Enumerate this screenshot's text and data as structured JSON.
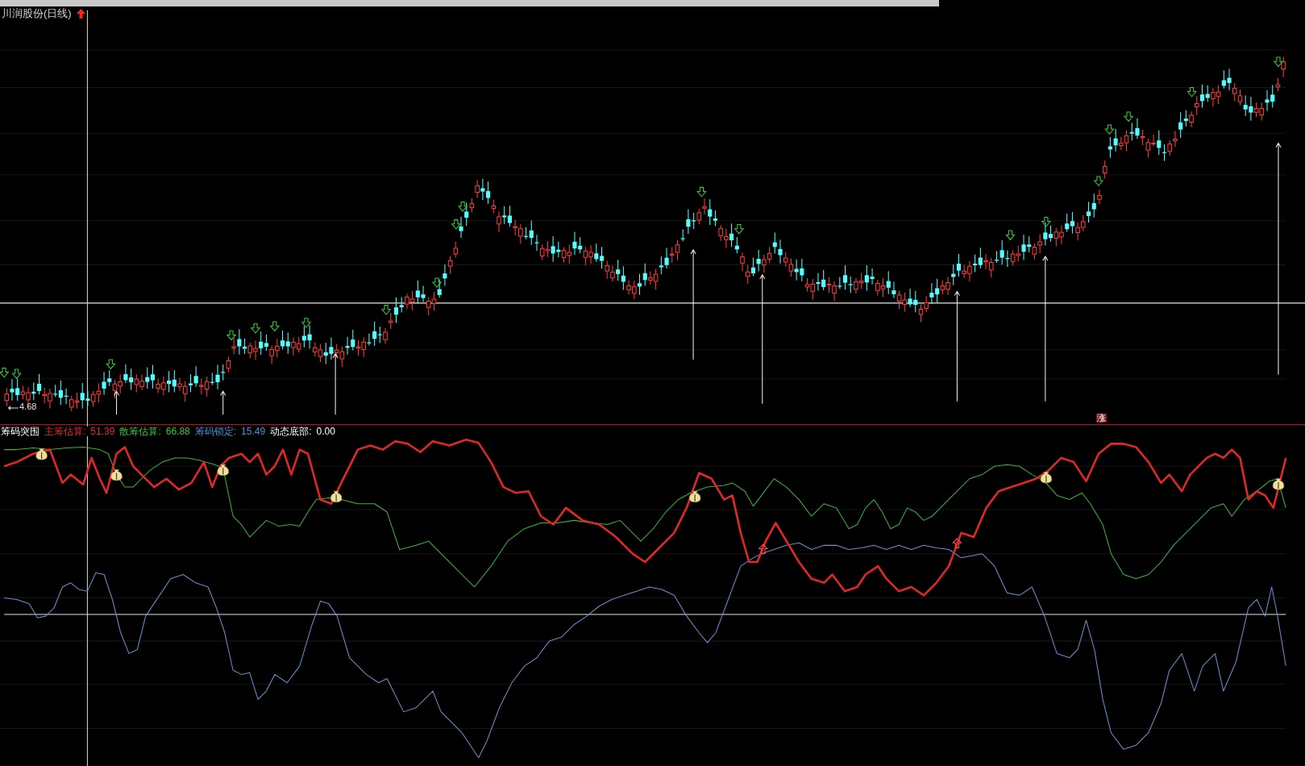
{
  "chart_title": "川润股份(日线)",
  "price_low_label": "4.68",
  "rise_marker": "涨",
  "indicator": {
    "name": "筹码突围",
    "readings": [
      {
        "label": "主筹估算:",
        "value": "51.39"
      },
      {
        "label": "散筹估算:",
        "value": "66.88"
      },
      {
        "label": "筹码锁定:",
        "value": "15.49"
      },
      {
        "label": "动态底部:",
        "value": "0.00"
      }
    ]
  }
}
